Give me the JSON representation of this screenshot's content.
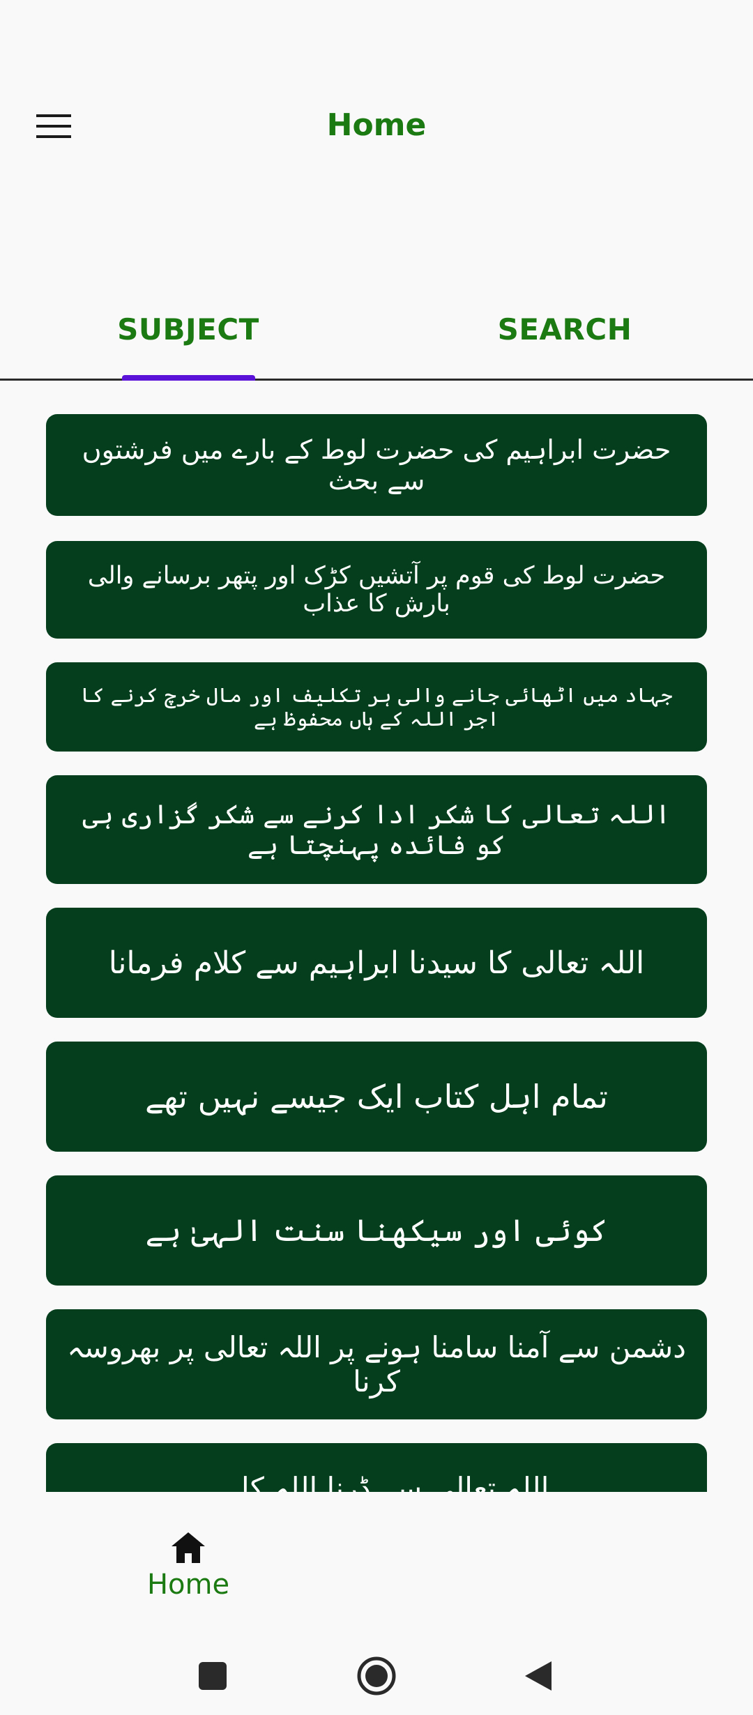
{
  "header": {
    "title": "Home"
  },
  "tabs": [
    {
      "label": "SUBJECT",
      "selected": true
    },
    {
      "label": "SEARCH",
      "selected": false
    }
  ],
  "subjects": [
    "حضرت ابراہیم کی حضرت لوط کے بارے میں فرشتوں سے بحث",
    "حضرت لوط کی قوم پر آتشیں کڑک اور پتھر برسانے والی بارش کا عذاب",
    "جہاد میں اٹھائی جانے والی ہر تکلیف اور مال خرچ کرنے کا اجر اللہ کے ہاں محفوظ ہے",
    "اللہ تعالی کا شکر ادا کرنے سے شکر گزاری ہی کو فائدہ پہنچتا ہے",
    "اللہ تعالی کا سیدنا ابراہیم سے کلام فرمانا",
    "تمام اہل کتاب ایک جیسے نہیں تھے",
    "کوئی اور سیکھنا سنت الہیٰ ہے",
    "دشمن سے آمنا سامنا ہونے پر اللہ تعالی پر بھروسہ کرنا",
    "اللہ تعالی سے ڈرنا اللہ کا ..."
  ],
  "bottom_nav": {
    "home_label": "Home"
  },
  "colors": {
    "accent_green": "#1c7a12",
    "card_bg": "#053e1c",
    "tab_indicator": "#5b12d8",
    "background": "#f9f9f9"
  },
  "icons": {
    "menu": "hamburger-menu-icon",
    "home": "home-icon",
    "recents": "square-recents-icon",
    "system_home": "circle-home-icon",
    "back": "triangle-back-icon"
  }
}
